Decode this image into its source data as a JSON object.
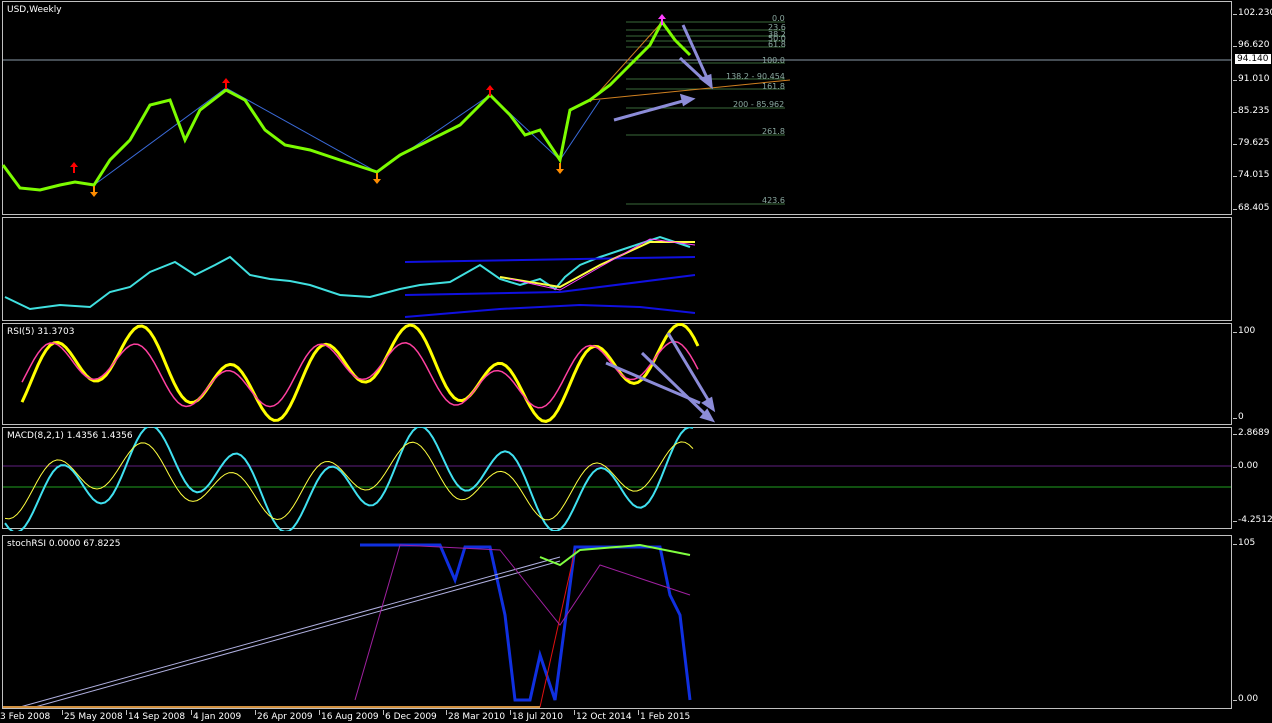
{
  "chart_window": {
    "symbol_label": "USD,Weekly",
    "price_ticks": [
      "102.230",
      "96.620",
      "91.010",
      "85.235",
      "79.625",
      "74.015",
      "68.405"
    ],
    "current_price": "94.140",
    "fib_levels": [
      "0.0",
      "23.6",
      "38.2",
      "50.0",
      "61.8",
      "100.0",
      "138.2 - 90.454",
      "161.8",
      "200 - 85.962",
      "261.8",
      "423.6"
    ],
    "colors": {
      "background": "#000000",
      "candles": "#7cfc00",
      "price_line": "#c0c0c0",
      "trend_line": "#4169e1",
      "arrow_up": "#ff8c00",
      "arrow_down": "#ff0000",
      "projection_arrow": "#8c8cd8"
    }
  },
  "indicator_panes": [
    {
      "id": "ma-cloud",
      "label": ""
    },
    {
      "id": "rsi",
      "label": "RSI(5) 31.3703",
      "ticks": [
        "100",
        "0"
      ]
    },
    {
      "id": "macd",
      "label": "MACD(8,2,1) 1.4356 1.4356",
      "ticks": [
        "2.8689",
        "0.00",
        "-4.2512"
      ]
    },
    {
      "id": "stochrsi",
      "label": "stochRSI 0.0000 67.8225",
      "ticks": [
        "105",
        "0.00"
      ]
    }
  ],
  "time_axis": [
    "3 Feb 2008",
    "25 May 2008",
    "14 Sep 2008",
    "4 Jan 2009",
    "26 Apr 2009",
    "16 Aug 2009",
    "6 Dec 2009",
    "28 Mar 2010",
    "18 Jul 2010",
    "12 Oct 2014",
    "1 Feb 2015"
  ]
}
